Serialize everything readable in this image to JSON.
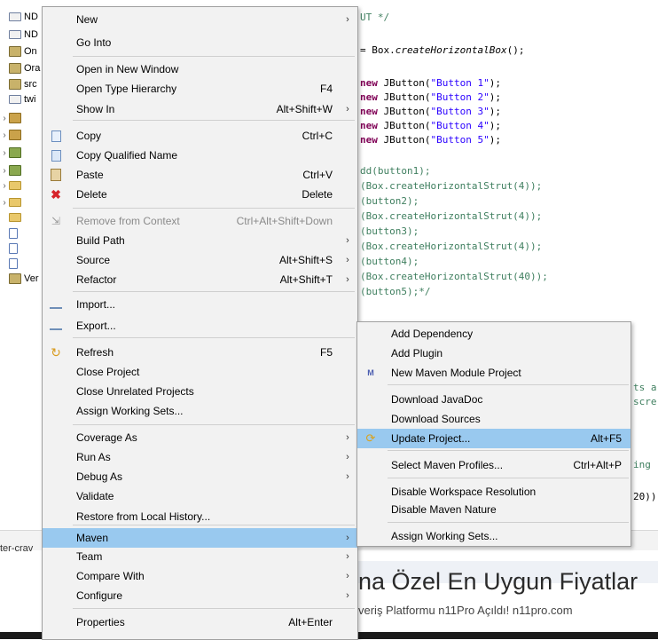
{
  "explorer": {
    "items": [
      {
        "label": "ND",
        "type": "proj"
      },
      {
        "label": "ND",
        "type": "proj"
      },
      {
        "label": "On",
        "type": "src"
      },
      {
        "label": "Ora",
        "type": "src"
      },
      {
        "label": "src",
        "type": "src"
      },
      {
        "label": "twi",
        "type": "proj"
      },
      {
        "label": "",
        "type": "pkg"
      },
      {
        "label": "",
        "type": "pkg"
      },
      {
        "label": "",
        "type": "lib"
      },
      {
        "label": "",
        "type": "lib"
      },
      {
        "label": "",
        "type": "folder"
      },
      {
        "label": "",
        "type": "folder"
      },
      {
        "label": "",
        "type": "folder"
      },
      {
        "label": "",
        "type": "file"
      },
      {
        "label": "",
        "type": "file"
      },
      {
        "label": "",
        "type": "file"
      },
      {
        "label": "Ver",
        "type": "src"
      }
    ]
  },
  "editor": {
    "lines": [
      {
        "parts": [
          {
            "t": "UT */",
            "c": "cm"
          }
        ]
      },
      {
        "parts": [
          {
            "t": "= Box.",
            "c": ""
          },
          {
            "t": "createHorizontalBox",
            "c": "it"
          },
          {
            "t": "();",
            "c": ""
          }
        ]
      },
      {
        "parts": [
          {
            "t": "new",
            "c": "kw"
          },
          {
            "t": " JButton(",
            "c": ""
          },
          {
            "t": "\"Button 1\"",
            "c": "str"
          },
          {
            "t": ");",
            "c": ""
          }
        ]
      },
      {
        "parts": [
          {
            "t": "new",
            "c": "kw"
          },
          {
            "t": " JButton(",
            "c": ""
          },
          {
            "t": "\"Button 2\"",
            "c": "str"
          },
          {
            "t": ");",
            "c": ""
          }
        ]
      },
      {
        "parts": [
          {
            "t": "new",
            "c": "kw"
          },
          {
            "t": " JButton(",
            "c": ""
          },
          {
            "t": "\"Button 3\"",
            "c": "str"
          },
          {
            "t": ");",
            "c": ""
          }
        ]
      },
      {
        "parts": [
          {
            "t": "new",
            "c": "kw"
          },
          {
            "t": " JButton(",
            "c": ""
          },
          {
            "t": "\"Button 4\"",
            "c": "str"
          },
          {
            "t": ");",
            "c": ""
          }
        ]
      },
      {
        "parts": [
          {
            "t": "new",
            "c": "kw"
          },
          {
            "t": " JButton(",
            "c": ""
          },
          {
            "t": "\"Button 5\"",
            "c": "str"
          },
          {
            "t": ");",
            "c": ""
          }
        ]
      },
      {
        "parts": [
          {
            "t": "dd(button1);",
            "c": "cm"
          }
        ]
      },
      {
        "parts": [
          {
            "t": "(Box.createHorizontalStrut(4));",
            "c": "cm"
          }
        ]
      },
      {
        "parts": [
          {
            "t": "(button2);",
            "c": "cm"
          }
        ]
      },
      {
        "parts": [
          {
            "t": "(Box.createHorizontalStrut(4));",
            "c": "cm"
          }
        ]
      },
      {
        "parts": [
          {
            "t": "(button3);",
            "c": "cm"
          }
        ]
      },
      {
        "parts": [
          {
            "t": "(Box.createHorizontalStrut(4));",
            "c": "cm"
          }
        ]
      },
      {
        "parts": [
          {
            "t": "(button4);",
            "c": "cm"
          }
        ]
      },
      {
        "parts": [
          {
            "t": "(Box.createHorizontalStrut(40));",
            "c": "cm"
          }
        ]
      },
      {
        "parts": [
          {
            "t": "(button5);*/",
            "c": "cm"
          }
        ]
      },
      {
        "parts": [
          {
            "t": "ts a",
            "c": "cm"
          }
        ]
      },
      {
        "parts": [
          {
            "t": "scre",
            "c": "cm"
          }
        ]
      },
      {
        "parts": [
          {
            "t": "ing",
            "c": "cm"
          }
        ]
      },
      {
        "parts": [
          {
            "t": "20))",
            "c": ""
          }
        ]
      }
    ]
  },
  "bottom": {
    "tab_label": "ter-crav",
    "ad_title": "na Özel En Uygun Fiyatlar",
    "ad_subtitle": "veriş Platformu n11Pro Açıldı! n11pro.com"
  },
  "context_menu": {
    "items": [
      {
        "label": "New",
        "accel": "",
        "submenu": true,
        "icon": ""
      },
      {
        "label": "Go Into",
        "accel": "",
        "submenu": false,
        "icon": ""
      },
      {
        "label": "Open in New Window",
        "accel": "",
        "submenu": false,
        "icon": ""
      },
      {
        "label": "Open Type Hierarchy",
        "accel": "F4",
        "submenu": false,
        "icon": ""
      },
      {
        "label": "Show In",
        "accel": "Alt+Shift+W",
        "submenu": true,
        "icon": ""
      },
      {
        "label": "Copy",
        "accel": "Ctrl+C",
        "submenu": false,
        "icon": "copy"
      },
      {
        "label": "Copy Qualified Name",
        "accel": "",
        "submenu": false,
        "icon": "copyq"
      },
      {
        "label": "Paste",
        "accel": "Ctrl+V",
        "submenu": false,
        "icon": "paste"
      },
      {
        "label": "Delete",
        "accel": "Delete",
        "submenu": false,
        "icon": "del"
      },
      {
        "label": "Remove from Context",
        "accel": "Ctrl+Alt+Shift+Down",
        "submenu": false,
        "icon": "rm",
        "disabled": true
      },
      {
        "label": "Build Path",
        "accel": "",
        "submenu": true,
        "icon": ""
      },
      {
        "label": "Source",
        "accel": "Alt+Shift+S",
        "submenu": true,
        "icon": ""
      },
      {
        "label": "Refactor",
        "accel": "Alt+Shift+T",
        "submenu": true,
        "icon": ""
      },
      {
        "label": "Import...",
        "accel": "",
        "submenu": false,
        "icon": "imp"
      },
      {
        "label": "Export...",
        "accel": "",
        "submenu": false,
        "icon": "exp"
      },
      {
        "label": "Refresh",
        "accel": "F5",
        "submenu": false,
        "icon": "refresh"
      },
      {
        "label": "Close Project",
        "accel": "",
        "submenu": false,
        "icon": ""
      },
      {
        "label": "Close Unrelated Projects",
        "accel": "",
        "submenu": false,
        "icon": ""
      },
      {
        "label": "Assign Working Sets...",
        "accel": "",
        "submenu": false,
        "icon": ""
      },
      {
        "label": "Coverage As",
        "accel": "",
        "submenu": true,
        "icon": ""
      },
      {
        "label": "Run As",
        "accel": "",
        "submenu": true,
        "icon": ""
      },
      {
        "label": "Debug As",
        "accel": "",
        "submenu": true,
        "icon": ""
      },
      {
        "label": "Validate",
        "accel": "",
        "submenu": false,
        "icon": ""
      },
      {
        "label": "Restore from Local History...",
        "accel": "",
        "submenu": false,
        "icon": ""
      },
      {
        "label": "Maven",
        "accel": "",
        "submenu": true,
        "icon": "",
        "highlighted": true
      },
      {
        "label": "Team",
        "accel": "",
        "submenu": true,
        "icon": ""
      },
      {
        "label": "Compare With",
        "accel": "",
        "submenu": true,
        "icon": ""
      },
      {
        "label": "Configure",
        "accel": "",
        "submenu": true,
        "icon": ""
      },
      {
        "label": "Properties",
        "accel": "Alt+Enter",
        "submenu": false,
        "icon": ""
      }
    ]
  },
  "maven_menu": {
    "items": [
      {
        "label": "Add Dependency",
        "accel": "",
        "icon": ""
      },
      {
        "label": "Add Plugin",
        "accel": "",
        "icon": ""
      },
      {
        "label": "New Maven Module Project",
        "accel": "",
        "icon": "maven"
      },
      {
        "label": "Download JavaDoc",
        "accel": "",
        "icon": ""
      },
      {
        "label": "Download Sources",
        "accel": "",
        "icon": ""
      },
      {
        "label": "Update Project...",
        "accel": "Alt+F5",
        "icon": "upd",
        "highlighted": true
      },
      {
        "label": "Select Maven Profiles...",
        "accel": "Ctrl+Alt+P",
        "icon": ""
      },
      {
        "label": "Disable Workspace Resolution",
        "accel": "",
        "icon": ""
      },
      {
        "label": "Disable Maven Nature",
        "accel": "",
        "icon": ""
      },
      {
        "label": "Assign Working Sets...",
        "accel": "",
        "icon": ""
      }
    ]
  },
  "colors": {
    "menu_bg": "#f2f2f2",
    "highlight": "#99c9ef",
    "keyword": "#7f0055",
    "string": "#2a00ff",
    "comment": "#3f7f5f"
  }
}
